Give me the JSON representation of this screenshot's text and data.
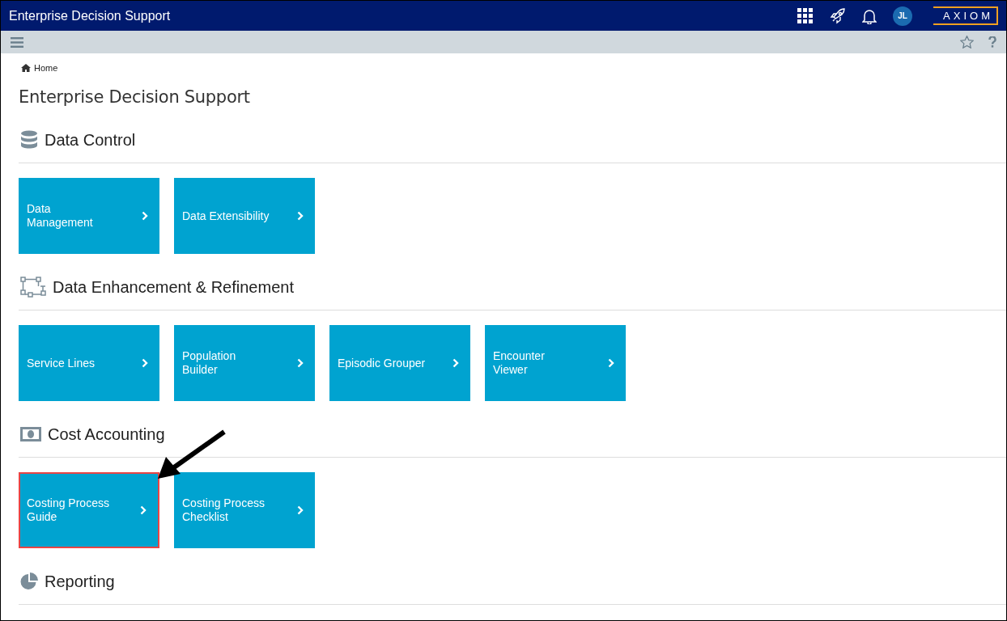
{
  "header": {
    "title": "Enterprise Decision Support",
    "avatar": "JL",
    "logo": "AXIOM"
  },
  "breadcrumb": {
    "label": "Home"
  },
  "page_title": "Enterprise Decision Support",
  "sections": [
    {
      "title": "Data Control",
      "tiles": [
        {
          "label": "Data\nManagement",
          "highlighted": false
        },
        {
          "label": "Data Extensibility",
          "highlighted": false
        }
      ]
    },
    {
      "title": "Data Enhancement & Refinement",
      "tiles": [
        {
          "label": "Service Lines",
          "highlighted": false
        },
        {
          "label": "Population\nBuilder",
          "highlighted": false
        },
        {
          "label": "Episodic Grouper",
          "highlighted": false
        },
        {
          "label": "Encounter\nViewer",
          "highlighted": false
        }
      ]
    },
    {
      "title": "Cost Accounting",
      "tiles": [
        {
          "label": "Costing Process\nGuide",
          "highlighted": true
        },
        {
          "label": "Costing Process\nChecklist",
          "highlighted": false
        }
      ]
    },
    {
      "title": "Reporting"
    }
  ]
}
